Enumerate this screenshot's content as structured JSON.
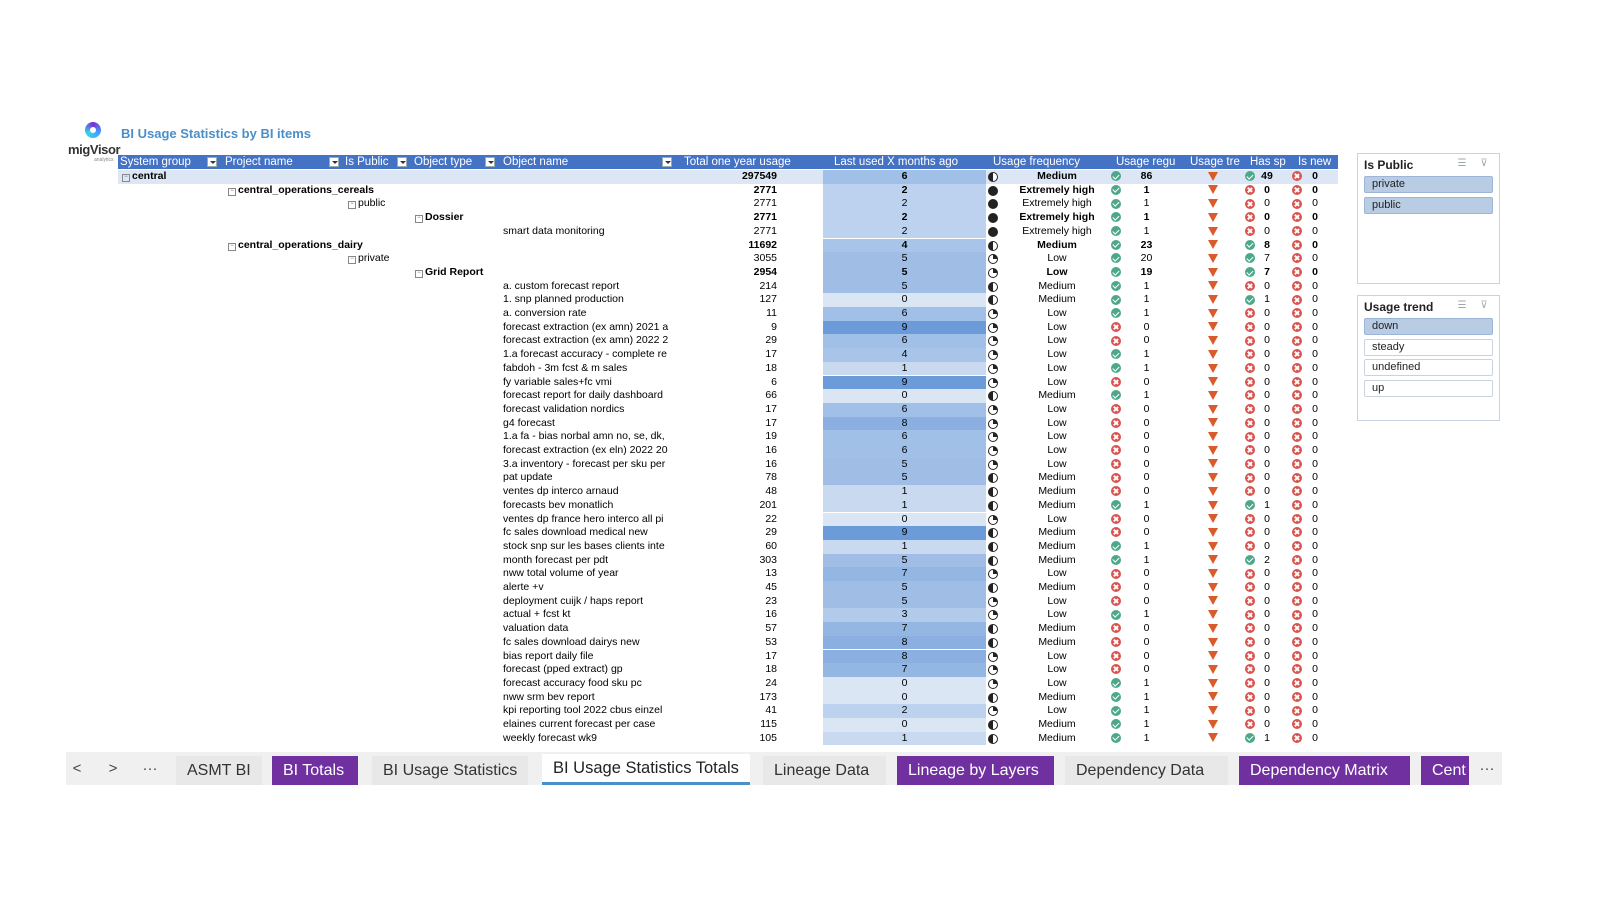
{
  "logo": {
    "name": "migVisor",
    "sub": "analytics"
  },
  "report": {
    "title": "BI Usage Statistics by BI items"
  },
  "headers": [
    "System group",
    "Project name",
    "Is Public",
    "Object type",
    "Object name",
    "Total one year usage",
    "Last used X months ago",
    "Usage frequency",
    "Usage regu",
    "Usage tre",
    "Has sp",
    "Is new"
  ],
  "rows": [
    {
      "lvl": 0,
      "label": "central",
      "bold": true,
      "total": "297549",
      "months": 6,
      "freq": "Medium",
      "reg_ok": true,
      "reg": "86",
      "sp_ok": true,
      "sp": "49",
      "new": "0"
    },
    {
      "lvl": 1,
      "label": "central_operations_cereals",
      "bold": true,
      "total": "2771",
      "months": 2,
      "freq": "Extremely high",
      "reg_ok": true,
      "reg": "1",
      "sp_ok": false,
      "sp": "0",
      "new": "0"
    },
    {
      "lvl": 2,
      "label": "public",
      "bold": false,
      "total": "2771",
      "months": 2,
      "freq": "Extremely high",
      "reg_ok": true,
      "reg": "1",
      "sp_ok": false,
      "sp": "0",
      "new": "0"
    },
    {
      "lvl": 3,
      "label": "Dossier",
      "bold": true,
      "total": "2771",
      "months": 2,
      "freq": "Extremely high",
      "reg_ok": true,
      "reg": "1",
      "sp_ok": false,
      "sp": "0",
      "new": "0"
    },
    {
      "lvl": 4,
      "label": "smart data monitoring",
      "bold": false,
      "total": "2771",
      "months": 2,
      "freq": "Extremely high",
      "reg_ok": true,
      "reg": "1",
      "sp_ok": false,
      "sp": "0",
      "new": "0"
    },
    {
      "lvl": 1,
      "label": "central_operations_dairy",
      "bold": true,
      "total": "11692",
      "months": 4,
      "freq": "Medium",
      "reg_ok": true,
      "reg": "23",
      "sp_ok": true,
      "sp": "8",
      "new": "0"
    },
    {
      "lvl": 2,
      "label": "private",
      "bold": false,
      "total": "3055",
      "months": 5,
      "freq": "Low",
      "reg_ok": true,
      "reg": "20",
      "sp_ok": true,
      "sp": "7",
      "new": "0"
    },
    {
      "lvl": 3,
      "label": "Grid Report",
      "bold": true,
      "total": "2954",
      "months": 5,
      "freq": "Low",
      "reg_ok": true,
      "reg": "19",
      "sp_ok": true,
      "sp": "7",
      "new": "0"
    },
    {
      "lvl": 4,
      "label": "a. custom forecast report",
      "bold": false,
      "total": "214",
      "months": 5,
      "freq": "Medium",
      "reg_ok": true,
      "reg": "1",
      "sp_ok": false,
      "sp": "0",
      "new": "0"
    },
    {
      "lvl": 4,
      "label": "1. snp planned production",
      "bold": false,
      "total": "127",
      "months": 0,
      "freq": "Medium",
      "reg_ok": true,
      "reg": "1",
      "sp_ok": true,
      "sp": "1",
      "new": "0"
    },
    {
      "lvl": 4,
      "label": "a. conversion rate",
      "bold": false,
      "total": "11",
      "months": 6,
      "freq": "Low",
      "reg_ok": true,
      "reg": "1",
      "sp_ok": false,
      "sp": "0",
      "new": "0"
    },
    {
      "lvl": 4,
      "label": "forecast extraction (ex amn) 2021 a",
      "bold": false,
      "total": "9",
      "months": 9,
      "freq": "Low",
      "reg_ok": false,
      "reg": "0",
      "sp_ok": false,
      "sp": "0",
      "new": "0"
    },
    {
      "lvl": 4,
      "label": "forecast extraction (ex amn) 2022 2",
      "bold": false,
      "total": "29",
      "months": 6,
      "freq": "Low",
      "reg_ok": false,
      "reg": "0",
      "sp_ok": false,
      "sp": "0",
      "new": "0"
    },
    {
      "lvl": 4,
      "label": "1.a forecast accuracy - complete re",
      "bold": false,
      "total": "17",
      "months": 4,
      "freq": "Low",
      "reg_ok": true,
      "reg": "1",
      "sp_ok": false,
      "sp": "0",
      "new": "0"
    },
    {
      "lvl": 4,
      "label": "fabdoh - 3m fcst & m sales",
      "bold": false,
      "total": "18",
      "months": 1,
      "freq": "Low",
      "reg_ok": true,
      "reg": "1",
      "sp_ok": false,
      "sp": "0",
      "new": "0"
    },
    {
      "lvl": 4,
      "label": "fy variable sales+fc vmi",
      "bold": false,
      "total": "6",
      "months": 9,
      "freq": "Low",
      "reg_ok": false,
      "reg": "0",
      "sp_ok": false,
      "sp": "0",
      "new": "0"
    },
    {
      "lvl": 4,
      "label": "forecast report for daily dashboard",
      "bold": false,
      "total": "66",
      "months": 0,
      "freq": "Medium",
      "reg_ok": true,
      "reg": "1",
      "sp_ok": false,
      "sp": "0",
      "new": "0"
    },
    {
      "lvl": 4,
      "label": "forecast validation nordics",
      "bold": false,
      "total": "17",
      "months": 6,
      "freq": "Low",
      "reg_ok": false,
      "reg": "0",
      "sp_ok": false,
      "sp": "0",
      "new": "0"
    },
    {
      "lvl": 4,
      "label": "g4 forecast",
      "bold": false,
      "total": "17",
      "months": 8,
      "freq": "Low",
      "reg_ok": false,
      "reg": "0",
      "sp_ok": false,
      "sp": "0",
      "new": "0"
    },
    {
      "lvl": 4,
      "label": "1.a fa - bias norbal amn no, se, dk,",
      "bold": false,
      "total": "19",
      "months": 6,
      "freq": "Low",
      "reg_ok": false,
      "reg": "0",
      "sp_ok": false,
      "sp": "0",
      "new": "0"
    },
    {
      "lvl": 4,
      "label": "forecast extraction (ex eln) 2022 20",
      "bold": false,
      "total": "16",
      "months": 6,
      "freq": "Low",
      "reg_ok": false,
      "reg": "0",
      "sp_ok": false,
      "sp": "0",
      "new": "0"
    },
    {
      "lvl": 4,
      "label": "3.a inventory - forecast per sku per",
      "bold": false,
      "total": "16",
      "months": 5,
      "freq": "Low",
      "reg_ok": false,
      "reg": "0",
      "sp_ok": false,
      "sp": "0",
      "new": "0"
    },
    {
      "lvl": 4,
      "label": "pat update",
      "bold": false,
      "total": "78",
      "months": 5,
      "freq": "Medium",
      "reg_ok": false,
      "reg": "0",
      "sp_ok": false,
      "sp": "0",
      "new": "0"
    },
    {
      "lvl": 4,
      "label": "ventes dp interco arnaud",
      "bold": false,
      "total": "48",
      "months": 1,
      "freq": "Medium",
      "reg_ok": false,
      "reg": "0",
      "sp_ok": false,
      "sp": "0",
      "new": "0"
    },
    {
      "lvl": 4,
      "label": "forecasts bev monatlich",
      "bold": false,
      "total": "201",
      "months": 1,
      "freq": "Medium",
      "reg_ok": true,
      "reg": "1",
      "sp_ok": true,
      "sp": "1",
      "new": "0"
    },
    {
      "lvl": 4,
      "label": "ventes dp france hero interco all pi",
      "bold": false,
      "total": "22",
      "months": 0,
      "freq": "Low",
      "reg_ok": false,
      "reg": "0",
      "sp_ok": false,
      "sp": "0",
      "new": "0"
    },
    {
      "lvl": 4,
      "label": "fc sales download medical new",
      "bold": false,
      "total": "29",
      "months": 9,
      "freq": "Medium",
      "reg_ok": false,
      "reg": "0",
      "sp_ok": false,
      "sp": "0",
      "new": "0"
    },
    {
      "lvl": 4,
      "label": "stock snp sur les bases clients inte",
      "bold": false,
      "total": "60",
      "months": 1,
      "freq": "Medium",
      "reg_ok": true,
      "reg": "1",
      "sp_ok": false,
      "sp": "0",
      "new": "0"
    },
    {
      "lvl": 4,
      "label": "month forecast per pdt",
      "bold": false,
      "total": "303",
      "months": 5,
      "freq": "Medium",
      "reg_ok": true,
      "reg": "1",
      "sp_ok": true,
      "sp": "2",
      "new": "0"
    },
    {
      "lvl": 4,
      "label": "nww total volume of year",
      "bold": false,
      "total": "13",
      "months": 7,
      "freq": "Low",
      "reg_ok": false,
      "reg": "0",
      "sp_ok": false,
      "sp": "0",
      "new": "0"
    },
    {
      "lvl": 4,
      "label": "alerte +v",
      "bold": false,
      "total": "45",
      "months": 5,
      "freq": "Medium",
      "reg_ok": false,
      "reg": "0",
      "sp_ok": false,
      "sp": "0",
      "new": "0"
    },
    {
      "lvl": 4,
      "label": "deployment cuijk / haps report",
      "bold": false,
      "total": "23",
      "months": 5,
      "freq": "Low",
      "reg_ok": false,
      "reg": "0",
      "sp_ok": false,
      "sp": "0",
      "new": "0"
    },
    {
      "lvl": 4,
      "label": "actual + fcst kt",
      "bold": false,
      "total": "16",
      "months": 3,
      "freq": "Low",
      "reg_ok": true,
      "reg": "1",
      "sp_ok": false,
      "sp": "0",
      "new": "0"
    },
    {
      "lvl": 4,
      "label": "valuation data",
      "bold": false,
      "total": "57",
      "months": 7,
      "freq": "Medium",
      "reg_ok": false,
      "reg": "0",
      "sp_ok": false,
      "sp": "0",
      "new": "0"
    },
    {
      "lvl": 4,
      "label": "fc sales download dairys new",
      "bold": false,
      "total": "53",
      "months": 8,
      "freq": "Medium",
      "reg_ok": false,
      "reg": "0",
      "sp_ok": false,
      "sp": "0",
      "new": "0"
    },
    {
      "lvl": 4,
      "label": "bias report daily file",
      "bold": false,
      "total": "17",
      "months": 8,
      "freq": "Low",
      "reg_ok": false,
      "reg": "0",
      "sp_ok": false,
      "sp": "0",
      "new": "0"
    },
    {
      "lvl": 4,
      "label": "forecast (pped extract) gp",
      "bold": false,
      "total": "18",
      "months": 7,
      "freq": "Low",
      "reg_ok": false,
      "reg": "0",
      "sp_ok": false,
      "sp": "0",
      "new": "0"
    },
    {
      "lvl": 4,
      "label": "forecast accuracy food sku pc",
      "bold": false,
      "total": "24",
      "months": 0,
      "freq": "Low",
      "reg_ok": true,
      "reg": "1",
      "sp_ok": false,
      "sp": "0",
      "new": "0"
    },
    {
      "lvl": 4,
      "label": "nww srm bev report",
      "bold": false,
      "total": "173",
      "months": 0,
      "freq": "Medium",
      "reg_ok": true,
      "reg": "1",
      "sp_ok": false,
      "sp": "0",
      "new": "0"
    },
    {
      "lvl": 4,
      "label": "kpi reporting tool 2022 cbus einzel",
      "bold": false,
      "total": "41",
      "months": 2,
      "freq": "Low",
      "reg_ok": true,
      "reg": "1",
      "sp_ok": false,
      "sp": "0",
      "new": "0"
    },
    {
      "lvl": 4,
      "label": "elaines current forecast per case",
      "bold": false,
      "total": "115",
      "months": 0,
      "freq": "Medium",
      "reg_ok": true,
      "reg": "1",
      "sp_ok": false,
      "sp": "0",
      "new": "0"
    },
    {
      "lvl": 4,
      "label": "weekly forecast wk9",
      "bold": false,
      "total": "105",
      "months": 1,
      "freq": "Medium",
      "reg_ok": true,
      "reg": "1",
      "sp_ok": true,
      "sp": "1",
      "new": "0"
    }
  ],
  "slicers": [
    {
      "title": "Is Public",
      "items": [
        {
          "label": "private",
          "selected": true
        },
        {
          "label": "public",
          "selected": true
        }
      ]
    },
    {
      "title": "Usage trend",
      "items": [
        {
          "label": "down",
          "selected": true
        },
        {
          "label": "steady",
          "selected": false
        },
        {
          "label": "undefined",
          "selected": false
        },
        {
          "label": "up",
          "selected": false
        }
      ]
    }
  ],
  "nav": {
    "prev": "<",
    "next": ">",
    "more": "···",
    "overflow": "···"
  },
  "tabs": [
    {
      "label": "ASMT BI",
      "style": "light"
    },
    {
      "label": "BI Totals",
      "style": "purple"
    },
    {
      "label": "BI Usage Statistics",
      "style": "light"
    },
    {
      "label": "BI Usage Statistics Totals",
      "style": "active"
    },
    {
      "label": "Lineage Data",
      "style": "light"
    },
    {
      "label": "Lineage by Layers",
      "style": "purple"
    },
    {
      "label": "Dependency Data",
      "style": "light"
    },
    {
      "label": "Dependency Matrix",
      "style": "purple"
    },
    {
      "label": "Cent",
      "style": "purple"
    }
  ],
  "colors": {
    "header": "#4472c4",
    "accent_purple": "#7030a0",
    "title": "#4a8fc9",
    "ok": "#4ca889",
    "bad": "#d9534f",
    "trend_down": "#d95a2b"
  }
}
